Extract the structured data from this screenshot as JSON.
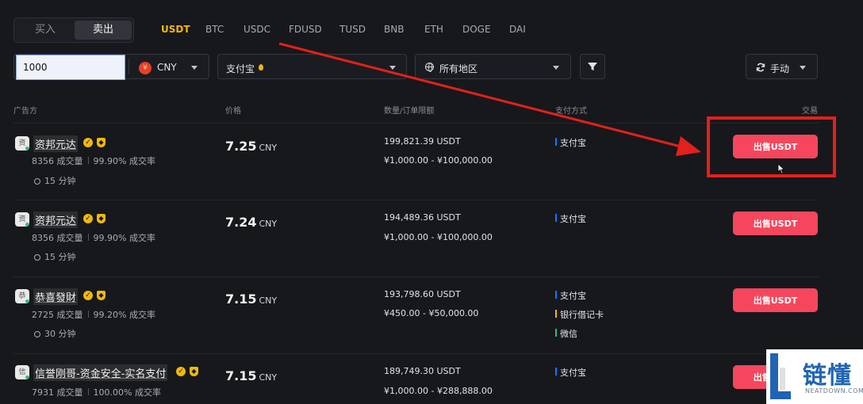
{
  "tabs": {
    "buy": "买入",
    "sell": "卖出"
  },
  "coins": [
    "USDT",
    "BTC",
    "USDC",
    "FDUSD",
    "TUSD",
    "BNB",
    "ETH",
    "DOGE",
    "DAI"
  ],
  "filters": {
    "amount": "1000",
    "currency": "CNY",
    "payment": "支付宝",
    "region": "所有地区",
    "refresh": "手动"
  },
  "columns": {
    "advertiser": "广告方",
    "price": "价格",
    "limit": "数量/订单限额",
    "payment": "支付方式",
    "trade": "交易"
  },
  "rows": [
    {
      "avatar": "资",
      "name": "资邦元达",
      "orders": "8356 成交量",
      "completion": "99.90% 成交率",
      "time": "15 分钟",
      "price": "7.25",
      "unit": "CNY",
      "available": "199,821.39 USDT",
      "limit": "¥1,000.00 - ¥100,000.00",
      "payments": [
        {
          "label": "支付宝",
          "color": "#1677ff"
        }
      ],
      "button": "出售USDT"
    },
    {
      "avatar": "资",
      "name": "资邦元达",
      "orders": "8356 成交量",
      "completion": "99.90% 成交率",
      "time": "15 分钟",
      "price": "7.24",
      "unit": "CNY",
      "available": "194,489.36 USDT",
      "limit": "¥1,000.00 - ¥100,000.00",
      "payments": [
        {
          "label": "支付宝",
          "color": "#1677ff"
        }
      ],
      "button": "出售USDT"
    },
    {
      "avatar": "恭",
      "name": "恭喜發財",
      "orders": "2725 成交量",
      "completion": "99.20% 成交率",
      "time": "30 分钟",
      "price": "7.15",
      "unit": "CNY",
      "available": "193,798.60 USDT",
      "limit": "¥450.00 - ¥50,000.00",
      "payments": [
        {
          "label": "支付宝",
          "color": "#1677ff"
        },
        {
          "label": "银行借记卡",
          "color": "#f0b90b"
        },
        {
          "label": "微信",
          "color": "#2ebd85"
        }
      ],
      "button": "出售USDT"
    },
    {
      "avatar": "信",
      "name": "信誉刚哥-资金安全-实名支付",
      "orders": "7931 成交量",
      "completion": "100.00% 成交率",
      "time": "",
      "price": "7.15",
      "unit": "CNY",
      "available": "189,749.30 USDT",
      "limit": "¥1,000.00 - ¥288,888.00",
      "payments": [
        {
          "label": "支付宝",
          "color": "#1677ff"
        }
      ],
      "button": "出售USDT"
    }
  ],
  "watermark": {
    "main": "链懂",
    "sub": "NEATDOWN.COM"
  },
  "colors": {
    "accent": "#f0b90b",
    "sell": "#f6465d",
    "annotation": "#e3201b"
  }
}
